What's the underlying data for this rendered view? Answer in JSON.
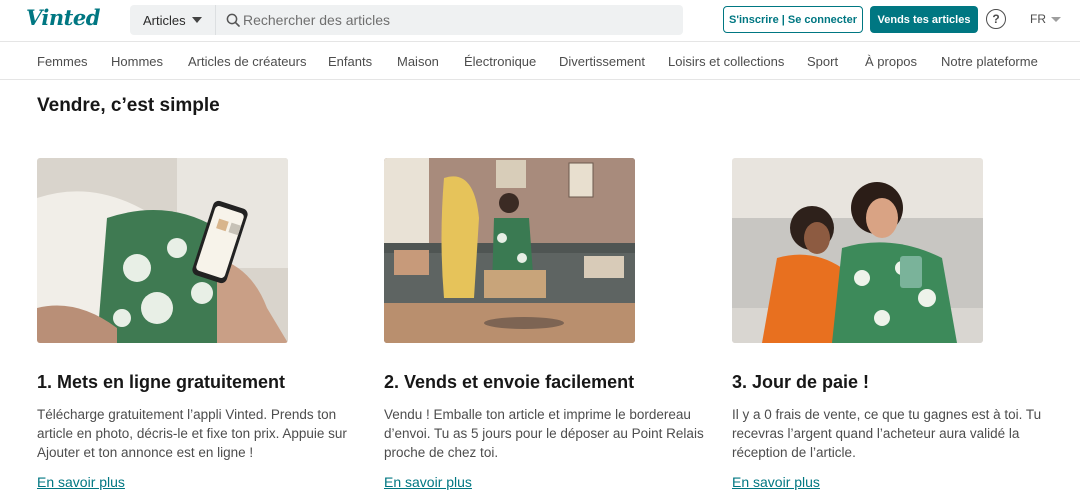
{
  "header": {
    "logo": "Vinted",
    "category_select": "Articles",
    "search_placeholder": "Rechercher des articles",
    "auth_button": "S'inscrire | Se connecter",
    "sell_button": "Vends tes articles",
    "help_icon": "?",
    "language": "FR"
  },
  "nav": {
    "items": [
      "Femmes",
      "Hommes",
      "Articles de créateurs",
      "Enfants",
      "Maison",
      "Électronique",
      "Divertissement",
      "Loisirs et collections",
      "Sport",
      "À propos",
      "Notre plateforme"
    ]
  },
  "main": {
    "title": "Vendre, c’est simple",
    "cards": [
      {
        "title": "1. Mets en ligne gratuitement",
        "text": "Télécharge gratuitement l’appli Vinted. Prends ton article en photo, décris-le et fixe ton prix. Appuie sur Ajouter et ton annonce est en ligne !",
        "link": "En savoir plus"
      },
      {
        "title": "2. Vends et envoie facilement",
        "text": "Vendu ! Emballe ton article et imprime le bordereau d’envoi. Tu as 5 jours pour le déposer au Point Relais proche de chez toi.",
        "link": "En savoir plus"
      },
      {
        "title": "3. Jour de paie !",
        "text": "Il y a 0 frais de vente, ce que tu gagnes est à toi. Tu recevras l’argent quand l’acheteur aura validé la réception de l’article.",
        "link": "En savoir plus"
      }
    ]
  },
  "colors": {
    "brand": "#007782",
    "text": "#171717",
    "muted": "#4d4d4d"
  }
}
